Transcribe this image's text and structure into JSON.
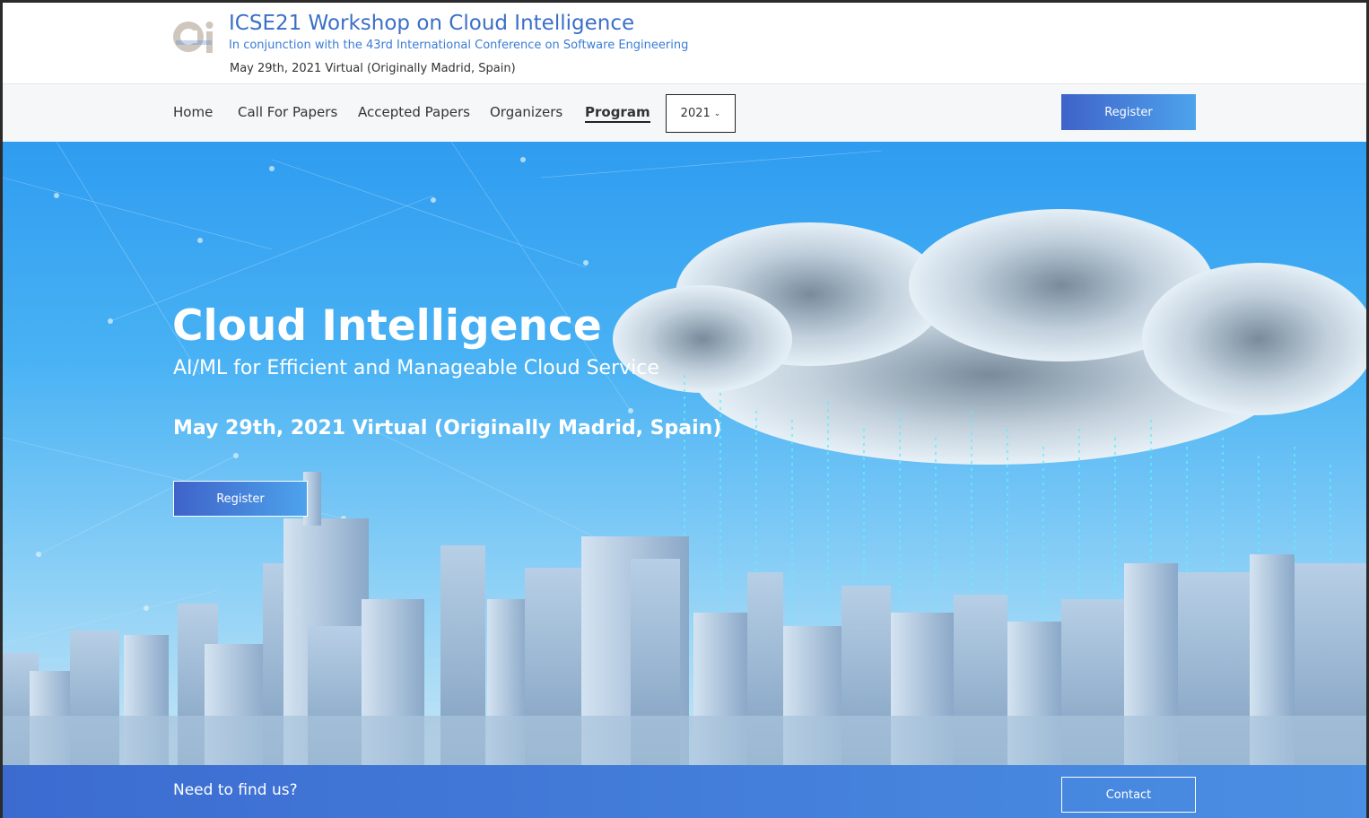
{
  "header": {
    "logo_text": "Ci",
    "title": "ICSE21 Workshop on Cloud Intelligence",
    "subtitle": "In conjunction with the 43rd International Conference on Software Engineering",
    "date": "May 29th, 2021 Virtual (Originally Madrid, Spain)"
  },
  "nav": {
    "items": [
      {
        "label": "Home"
      },
      {
        "label": "Call For Papers"
      },
      {
        "label": "Accepted Papers"
      },
      {
        "label": "Organizers"
      },
      {
        "label": "Program"
      }
    ],
    "active": "Program",
    "year_select": "2021",
    "register_label": "Register"
  },
  "hero": {
    "title": "Cloud Intelligence",
    "tagline": "AI/ML for Efficient and Manageable Cloud Service",
    "date": "May 29th, 2021 Virtual (Originally Madrid, Spain)",
    "register_label": "Register"
  },
  "footer": {
    "text": "Need to find us?",
    "contact_label": "Contact"
  },
  "colors": {
    "accent": "#3b6fc7",
    "button_start": "#3f63c9",
    "button_end": "#4da3ec"
  }
}
